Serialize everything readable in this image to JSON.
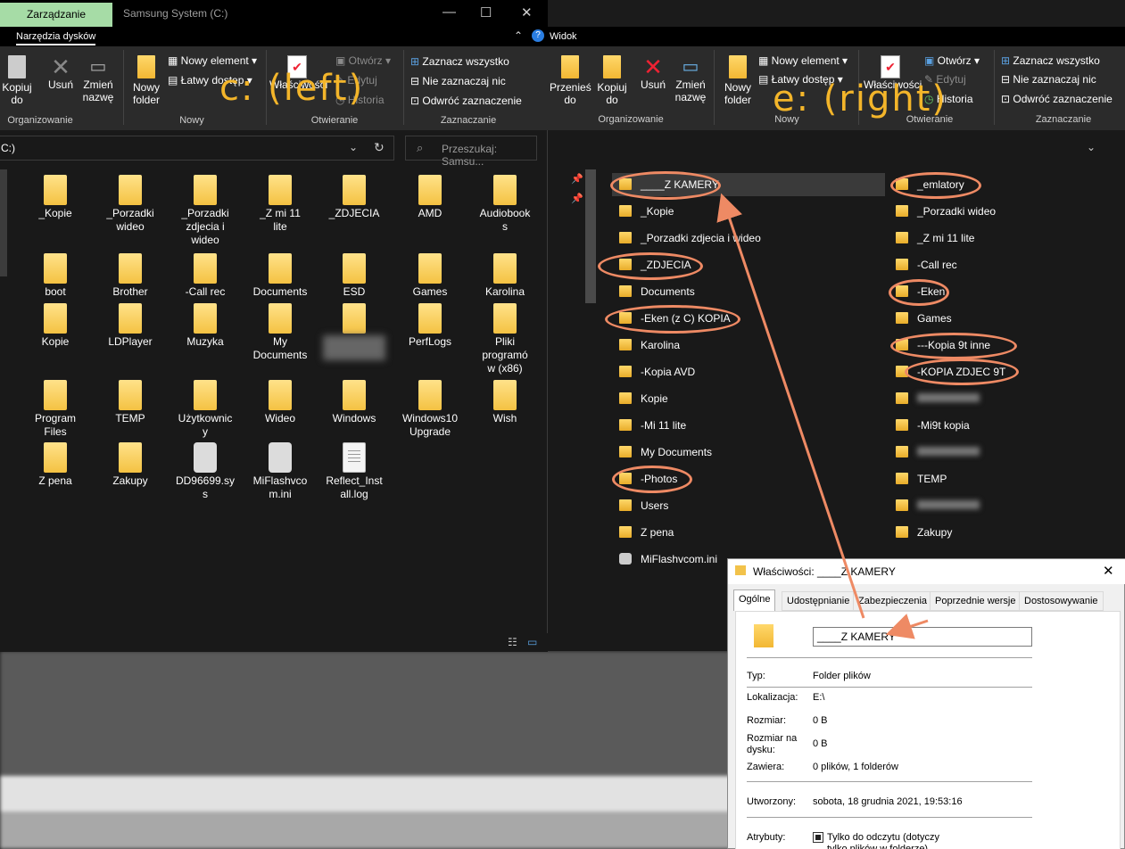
{
  "left_window": {
    "tab_manage": "Zarządzanie",
    "title": "Samsung System (C:)",
    "subtab": "Narzędzia dysków",
    "ribbon": {
      "copy_to": "Kopiuj\ndo",
      "delete": "Usuń",
      "rename": "Zmień\nnazwę",
      "new_folder": "Nowy\nfolder",
      "new_item": "Nowy element",
      "easy_access": "Łatwy dostęp",
      "properties": "Właściwości",
      "open": "Otwórz",
      "edit": "Edytuj",
      "history": "Historia",
      "select_all": "Zaznacz wszystko",
      "select_none": "Nie zaznaczaj nic",
      "invert_selection": "Odwróć zaznaczenie",
      "group_organize": "Organizowanie",
      "group_new": "Nowy",
      "group_open": "Otwieranie",
      "group_select": "Zaznaczanie"
    },
    "address": "C:)",
    "search_placeholder": "Przeszukaj: Samsu...",
    "items": [
      {
        "name": "_Kopie",
        "type": "folder"
      },
      {
        "name": "_Porzadki\nwideo",
        "type": "folder"
      },
      {
        "name": "_Porzadki\nzdjecia i\nwideo",
        "type": "folder-doc"
      },
      {
        "name": "_Z mi 11\nlite",
        "type": "folder"
      },
      {
        "name": "_ZDJECIA",
        "type": "folder-img"
      },
      {
        "name": "AMD",
        "type": "folder"
      },
      {
        "name": "Audiobook\ns",
        "type": "folder"
      },
      {
        "name": "boot",
        "type": "folder"
      },
      {
        "name": "Brother",
        "type": "folder"
      },
      {
        "name": "-Call rec",
        "type": "folder"
      },
      {
        "name": "Documents",
        "type": "folder"
      },
      {
        "name": "ESD",
        "type": "folder"
      },
      {
        "name": "Games",
        "type": "folder"
      },
      {
        "name": "Karolina",
        "type": "folder"
      },
      {
        "name": "Kopie",
        "type": "folder"
      },
      {
        "name": "LDPlayer",
        "type": "folder"
      },
      {
        "name": "Muzyka",
        "type": "folder"
      },
      {
        "name": "My\nDocuments",
        "type": "folder"
      },
      {
        "name": "",
        "type": "folder"
      },
      {
        "name": "PerfLogs",
        "type": "folder"
      },
      {
        "name": "Pliki\nprogramó\nw (x86)",
        "type": "folder"
      },
      {
        "name": "Program\nFiles",
        "type": "folder"
      },
      {
        "name": "TEMP",
        "type": "folder"
      },
      {
        "name": "Użytkownic\ny",
        "type": "folder"
      },
      {
        "name": "Wideo",
        "type": "folder"
      },
      {
        "name": "Windows",
        "type": "folder"
      },
      {
        "name": "Windows10\nUpgrade",
        "type": "folder"
      },
      {
        "name": "Wish",
        "type": "folder"
      },
      {
        "name": "Z pena",
        "type": "folder"
      },
      {
        "name": "Zakupy",
        "type": "folder"
      },
      {
        "name": "DD96699.sy\ns",
        "type": "gear"
      },
      {
        "name": "MiFlashvco\nm.ini",
        "type": "gear"
      },
      {
        "name": "Reflect_Inst\nall.log",
        "type": "doc"
      }
    ]
  },
  "right_window": {
    "subtab": "Widok",
    "ribbon": {
      "move_to": "Przenieś\ndo",
      "copy_to": "Kopiuj\ndo",
      "delete": "Usuń",
      "rename": "Zmień\nnazwę",
      "new_folder": "Nowy\nfolder",
      "new_item": "Nowy element",
      "easy_access": "Łatwy dostęp",
      "properties": "Właściwości",
      "open": "Otwórz",
      "edit": "Edytuj",
      "history": "Historia",
      "select_all": "Zaznacz wszystko",
      "select_none": "Nie zaznaczaj nic",
      "invert_selection": "Odwróć zaznaczenie",
      "group_organize": "Organizowanie",
      "group_new": "Nowy",
      "group_open": "Otwieranie",
      "group_select": "Zaznaczanie"
    },
    "col1": [
      "____Z KAMERY",
      "_Kopie",
      "_Porzadki zdjecia i wideo",
      "_ZDJECIA",
      "Documents",
      "-Eken (z C) KOPIA",
      "Karolina",
      "-Kopia AVD",
      "Kopie",
      "-Mi 11 lite",
      "My Documents",
      "-Photos",
      "Users",
      "Z pena",
      "MiFlashvcom.ini"
    ],
    "col2": [
      "_emlatory",
      "_Porzadki wideo",
      "_Z mi 11 lite",
      "-Call rec",
      "-Eken",
      "Games",
      "---Kopia 9t inne",
      "-KOPIA ZDJEC 9T",
      "",
      "-Mi9t kopia",
      "",
      "TEMP",
      "",
      "Zakupy"
    ]
  },
  "overlays": {
    "left_label": "c: (left)",
    "right_label": "e: (right)"
  },
  "properties": {
    "title": "Właściwości: ____Z KAMERY",
    "tabs": [
      "Ogólne",
      "Udostępnianie",
      "Zabezpieczenia",
      "Poprzednie wersje",
      "Dostosowywanie"
    ],
    "name_value": "____Z KAMERY",
    "type_label": "Typ:",
    "type_value": "Folder plików",
    "location_label": "Lokalizacja:",
    "location_value": "E:\\",
    "size_label": "Rozmiar:",
    "size_value": "0 B",
    "size_on_disk_label": "Rozmiar na\ndysku:",
    "size_on_disk_value": "0 B",
    "contains_label": "Zawiera:",
    "contains_value": "0 plików, 1 folderów",
    "created_label": "Utworzony:",
    "created_value": "sobota, 18 grudnia 2021, 19:53:16",
    "attributes_label": "Atrybuty:",
    "readonly_value": "Tylko do odczytu (dotyczy\ntylko plików w folderze)"
  },
  "colors": {
    "accent_tab": "#a6dca6",
    "annotation": "#ee8a64",
    "overlay_text": "#f3b52a"
  }
}
